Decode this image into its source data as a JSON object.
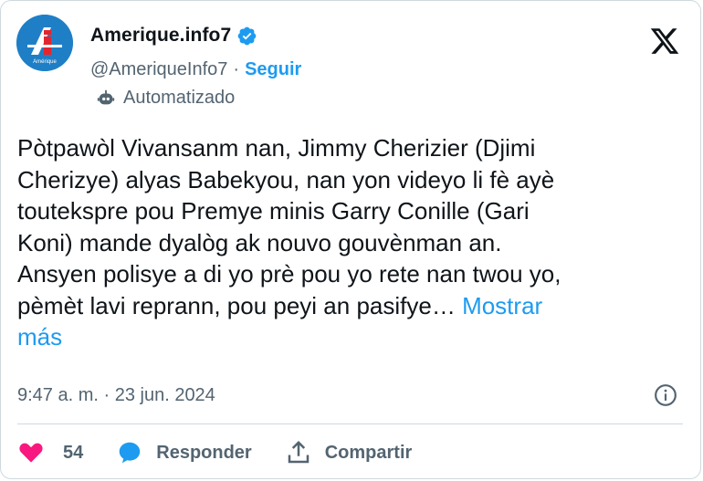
{
  "author": {
    "display_name": "Amerique.info7",
    "handle": "@AmeriqueInfo7",
    "separator": "·",
    "follow_label": "Seguir",
    "automated_label": "Automatizado",
    "avatar_text": "Amérique"
  },
  "tweet": {
    "text": "Pòtpawòl Vivansanm nan, Jimmy Cherizier (Djimi\nCherizye) alyas Babekyou, nan yon videyo li fè ayè\ntoutekspre pou Premye minis Garry Conille (Gari\nKoni) mande dyalòg ak nouvo gouvènman an.\nAnsyen polisye a di yo prè pou yo rete nan twou yo,\npèmèt lavi reprann, pou peyi an pasifye… ",
    "show_more_label": "Mostrar\nmás",
    "timestamp": "9:47 a. m. · 23 jun. 2024"
  },
  "actions": {
    "like_count": "54",
    "reply_label": "Responder",
    "share_label": "Compartir"
  },
  "colors": {
    "accent": "#1d9bf0",
    "like": "#f91880",
    "text": "#0f1419",
    "muted": "#536471",
    "avatar_bg": "#1f7fc6"
  },
  "icons": [
    "verified-badge-icon",
    "bot-icon",
    "x-logo-icon",
    "info-icon",
    "heart-icon",
    "reply-icon",
    "share-icon"
  ]
}
